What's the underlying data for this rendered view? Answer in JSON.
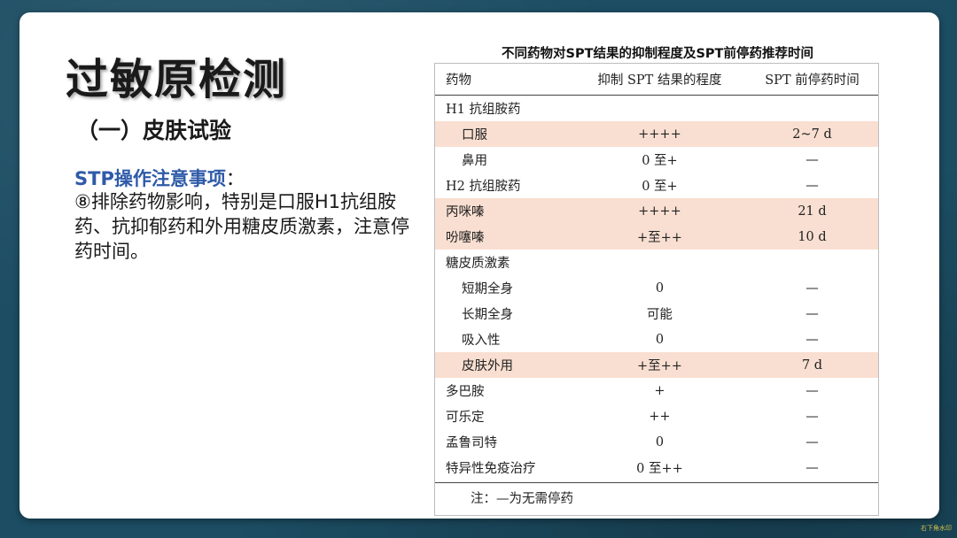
{
  "slide": {
    "title": "过敏原检测",
    "subtitle": "（一）皮肤试验",
    "note_title": "STP操作注意事项",
    "note_colon": "：",
    "note_body": "⑧排除药物影响，特别是口服H1抗组胺药、抗抑郁药和外用糖皮质激素，注意停药时间。"
  },
  "table": {
    "caption": "不同药物对SPT结果的抑制程度及SPT前停药推荐时间",
    "headers": [
      "药物",
      "抑制 SPT 结果的程度",
      "SPT 前停药时间"
    ],
    "rows": [
      {
        "drug": "H1 抗组胺药",
        "degree": "",
        "stop": ""
      },
      {
        "drug": "口服",
        "degree": "++++",
        "stop": "2~7 d"
      },
      {
        "drug": "鼻用",
        "degree": "0 至+",
        "stop": "—"
      },
      {
        "drug": "H2 抗组胺药",
        "degree": "0 至+",
        "stop": "—"
      },
      {
        "drug": "丙咪嗪",
        "degree": "++++",
        "stop": "21 d"
      },
      {
        "drug": "吩噻嗪",
        "degree": "+至++",
        "stop": "10 d"
      },
      {
        "drug": "糖皮质激素",
        "degree": "",
        "stop": ""
      },
      {
        "drug": "短期全身",
        "degree": "0",
        "stop": "—"
      },
      {
        "drug": "长期全身",
        "degree": "可能",
        "stop": "—"
      },
      {
        "drug": "吸入性",
        "degree": "0",
        "stop": "—"
      },
      {
        "drug": "皮肤外用",
        "degree": "+至++",
        "stop": "7 d"
      },
      {
        "drug": "多巴胺",
        "degree": "+",
        "stop": "—"
      },
      {
        "drug": "可乐定",
        "degree": "++",
        "stop": "—"
      },
      {
        "drug": "孟鲁司特",
        "degree": "0",
        "stop": "—"
      },
      {
        "drug": "特异性免疫治疗",
        "degree": "0 至++",
        "stop": "—"
      }
    ],
    "footnote": "注：—为无需停药"
  },
  "watermark": "右下角水印",
  "colors": {
    "highlight_row": "#f9dfd1",
    "note_title": "#2e5aa8",
    "background": "#1c4d63"
  }
}
